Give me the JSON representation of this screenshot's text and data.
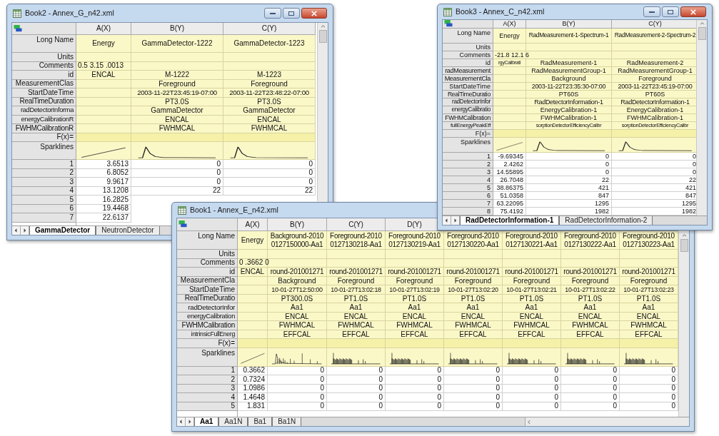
{
  "windows": [
    {
      "title": "Book2 - Annex_G_n42.xml",
      "header": [
        "A(X)",
        "B(Y)",
        "C(Y)"
      ],
      "label_rows": [
        {
          "label": "Long Name",
          "kind": "long_name",
          "cells": [
            "Energy",
            "GammaDetector-1222",
            "GammaDetector-1223"
          ]
        },
        {
          "label": "Units",
          "kind": "meta"
        },
        {
          "label": "Comments",
          "kind": "comments",
          "cells": [
            "0.5 3.15 .0013"
          ]
        },
        {
          "label": "id",
          "kind": "meta",
          "cells": [
            "ENCAL",
            "M-1222",
            "M-1223"
          ]
        },
        {
          "label": "MeasurementClas",
          "kind": "meta",
          "cells": [
            null,
            "Foreground",
            "Foreground"
          ]
        },
        {
          "label": "StartDateTime",
          "kind": "meta",
          "cells": [
            null,
            "2003-11-22T23:45:19-07:00",
            "2003-11-22T23:48:22-07:00"
          ]
        },
        {
          "label": "RealTimeDuration",
          "kind": "meta",
          "cells": [
            null,
            "PT3.0S",
            "PT3.0S"
          ]
        },
        {
          "label": "radDetectorInforma",
          "kind": "meta",
          "cells": [
            null,
            "GammaDetector",
            "GammaDetector"
          ]
        },
        {
          "label": "energyCalibrationR",
          "kind": "meta",
          "cells": [
            null,
            "ENCAL",
            "ENCAL"
          ]
        },
        {
          "label": "FWHMCalibrationR",
          "kind": "meta",
          "cells": [
            null,
            "FWHMCAL",
            "FWHMCAL"
          ]
        },
        {
          "label": "F(x)=",
          "kind": "formula"
        }
      ],
      "sparklines": {
        "label": "Sparklines",
        "cells": [
          {
            "kind": "ramp"
          },
          {
            "kind": "peak"
          },
          {
            "kind": "peak"
          }
        ]
      },
      "data_rows": [
        {
          "label": "1",
          "cells": [
            "3.6513",
            "0",
            "0"
          ]
        },
        {
          "label": "2",
          "cells": [
            "6.8052",
            "0",
            "0"
          ]
        },
        {
          "label": "3",
          "cells": [
            "9.9617",
            "0",
            "0"
          ]
        },
        {
          "label": "4",
          "cells": [
            "13.1208",
            "22",
            "22"
          ]
        },
        {
          "label": "5",
          "cells": [
            "16.2825"
          ]
        },
        {
          "label": "6",
          "cells": [
            "19.4468"
          ]
        },
        {
          "label": "7",
          "cells": [
            "22.6137"
          ]
        }
      ],
      "tabs": [
        {
          "label": "GammaDetector",
          "selected": true
        },
        {
          "label": "NeutronDetector",
          "selected": false
        }
      ]
    },
    {
      "title": "Book3 - Annex_C_n42.xml",
      "header": [
        "A(X)",
        "B(Y)",
        "C(Y)"
      ],
      "label_rows": [
        {
          "label": "Long Name",
          "kind": "long_name",
          "cells": [
            "Energy",
            "RadMeasurement-1-Spectrum-1",
            "RadMeasurement-2-Spectrum-2"
          ]
        },
        {
          "label": "Units",
          "kind": "meta"
        },
        {
          "label": "Comments",
          "kind": "comments",
          "cells": [
            "-21.8 12.1 6"
          ]
        },
        {
          "label": "id",
          "kind": "meta",
          "cells": [
            "rgyCalibrati",
            "RadMeasurement-1",
            "RadMeasurement-2"
          ]
        },
        {
          "label": "radMeasurement",
          "kind": "meta",
          "cells": [
            null,
            "RadMeasurementGroup-1",
            "RadMeasurementGroup-1"
          ]
        },
        {
          "label": "MeasurementCla",
          "kind": "meta",
          "cells": [
            null,
            "Background",
            "Foreground"
          ]
        },
        {
          "label": "StartDateTime",
          "kind": "meta",
          "cells": [
            null,
            "2003-11-22T23:35:30-07:00",
            "2003-11-22T23:45:19-07:00"
          ]
        },
        {
          "label": "RealTimeDuratio",
          "kind": "meta",
          "cells": [
            null,
            "PT60S",
            "PT60S"
          ]
        },
        {
          "label": "radDetectorInfor",
          "kind": "meta",
          "cells": [
            null,
            "RadDetectorInformation-1",
            "RadDetectorInformation-1"
          ]
        },
        {
          "label": "energyCalibratio",
          "kind": "meta",
          "cells": [
            null,
            "EnergyCalibration-1",
            "EnergyCalibration-1"
          ]
        },
        {
          "label": "FWHMCalibration",
          "kind": "meta",
          "cells": [
            null,
            "FWHMCalibration-1",
            "FWHMCalibration-1"
          ]
        },
        {
          "label": "fullEnergyPeakEff",
          "kind": "meta",
          "cells": [
            null,
            "sorptionDetectorEfficiencyCalibr",
            "sorptionDetectorEfficiencyCalibr"
          ]
        },
        {
          "label": "F(x)=",
          "kind": "formula"
        }
      ],
      "sparklines": {
        "label": "Sparklines",
        "cells": [
          {
            "kind": "ramp"
          },
          {
            "kind": "peak"
          },
          {
            "kind": "peak"
          }
        ]
      },
      "data_rows": [
        {
          "label": "1",
          "cells": [
            "-9.69345",
            "0",
            "0"
          ]
        },
        {
          "label": "2",
          "cells": [
            "2.4262",
            "0",
            "0"
          ]
        },
        {
          "label": "3",
          "cells": [
            "14.55895",
            "0",
            "0"
          ]
        },
        {
          "label": "4",
          "cells": [
            "26.7048",
            "22",
            "22"
          ]
        },
        {
          "label": "5",
          "cells": [
            "38.86375",
            "421",
            "421"
          ]
        },
        {
          "label": "6",
          "cells": [
            "51.0358",
            "847",
            "847"
          ]
        },
        {
          "label": "7",
          "cells": [
            "63.22095",
            "1295",
            "1295"
          ]
        },
        {
          "label": "8",
          "cells": [
            "75.4192",
            "1982",
            "1982"
          ]
        }
      ],
      "tabs": [
        {
          "label": "RadDetectorInformation-1",
          "selected": true
        },
        {
          "label": "RadDetectorInformation-2",
          "selected": false
        }
      ]
    },
    {
      "title": "Book1 - Annex_E_n42.xml",
      "header": [
        "A(X)",
        "B(Y)",
        "C(Y)",
        "D(Y)"
      ],
      "label_rows": [
        {
          "label": "Long Name",
          "kind": "long_name",
          "cells": [
            "Energy",
            "Background-2010\n0127150000-Aa1",
            "Foreground-2010\n0127130218-Aa1",
            "Foreground-2010\n0127130219-Aa1",
            "Foreground-2010\n0127130220-Aa1",
            "Foreground-2010\n0127130221-Aa1",
            "Foreground-2010\n0127130222-Aa1",
            "Foreground-2010\n0127130223-Aa1"
          ]
        },
        {
          "label": "Units",
          "kind": "meta"
        },
        {
          "label": "Comments",
          "kind": "comments",
          "cells": [
            "0 .3662 0"
          ]
        },
        {
          "label": "id",
          "kind": "meta",
          "cells": [
            "ENCAL",
            "round-201001271",
            "round-201001271",
            "round-201001271",
            "round-201001271",
            "round-201001271",
            "round-201001271",
            "round-201001271"
          ]
        },
        {
          "label": "MeasurementCla",
          "kind": "meta",
          "cells": [
            null,
            "Background",
            "Foreground",
            "Foreground",
            "Foreground",
            "Foreground",
            "Foreground",
            "Foreground"
          ]
        },
        {
          "label": "StartDateTime",
          "kind": "meta",
          "cells": [
            null,
            "10-01-27T12:50:00",
            "10-01-27T13:02:18",
            "10-01-27T13:02:19",
            "10-01-27T13:02:20",
            "10-01-27T13:02:21",
            "10-01-27T13:02:22",
            "10-01-27T13:02:23"
          ]
        },
        {
          "label": "RealTimeDuratio",
          "kind": "meta",
          "cells": [
            null,
            "PT300.0S",
            "PT1.0S",
            "PT1.0S",
            "PT1.0S",
            "PT1.0S",
            "PT1.0S",
            "PT1.0S"
          ]
        },
        {
          "label": "radDetectorInfor",
          "kind": "meta",
          "cells": [
            null,
            "Aa1",
            "Aa1",
            "Aa1",
            "Aa1",
            "Aa1",
            "Aa1",
            "Aa1"
          ]
        },
        {
          "label": "energyCalibration",
          "kind": "meta",
          "cells": [
            null,
            "ENCAL",
            "ENCAL",
            "ENCAL",
            "ENCAL",
            "ENCAL",
            "ENCAL",
            "ENCAL"
          ]
        },
        {
          "label": "FWHMCalibration",
          "kind": "meta",
          "cells": [
            null,
            "FWHMCAL",
            "FWHMCAL",
            "FWHMCAL",
            "FWHMCAL",
            "FWHMCAL",
            "FWHMCAL",
            "FWHMCAL"
          ]
        },
        {
          "label": "intrinsicFullEnerg",
          "kind": "meta",
          "cells": [
            null,
            "EFFCAL",
            "EFFCAL",
            "EFFCAL",
            "EFFCAL",
            "EFFCAL",
            "EFFCAL",
            "EFFCAL"
          ]
        },
        {
          "label": "F(x)=",
          "kind": "formula"
        }
      ],
      "sparklines": {
        "label": "Sparklines",
        "cells": [
          {
            "kind": "ramp"
          },
          {
            "kind": "decay"
          },
          {
            "kind": "comb"
          },
          {
            "kind": "comb"
          },
          {
            "kind": "comb"
          },
          {
            "kind": "comb"
          },
          {
            "kind": "comb"
          },
          {
            "kind": "comb"
          }
        ]
      },
      "data_rows": [
        {
          "label": "1",
          "cells": [
            "0.3662",
            "0",
            "0",
            "0",
            "0",
            "0",
            "0",
            "0"
          ]
        },
        {
          "label": "2",
          "cells": [
            "0.7324",
            "0",
            "0",
            "0",
            "0",
            "0",
            "0",
            "0"
          ]
        },
        {
          "label": "3",
          "cells": [
            "1.0986",
            "0",
            "0",
            "0",
            "0",
            "0",
            "0",
            "0"
          ]
        },
        {
          "label": "4",
          "cells": [
            "1.4648",
            "0",
            "0",
            "0",
            "0",
            "0",
            "0",
            "0"
          ]
        },
        {
          "label": "5",
          "cells": [
            "1.831",
            "0",
            "0",
            "0",
            "0",
            "0",
            "0",
            "0"
          ]
        }
      ],
      "tabs": [
        {
          "label": "Aa1",
          "selected": true
        },
        {
          "label": "Aa1N",
          "selected": false
        },
        {
          "label": "Ba1",
          "selected": false
        },
        {
          "label": "Ba1N",
          "selected": false
        }
      ]
    }
  ]
}
